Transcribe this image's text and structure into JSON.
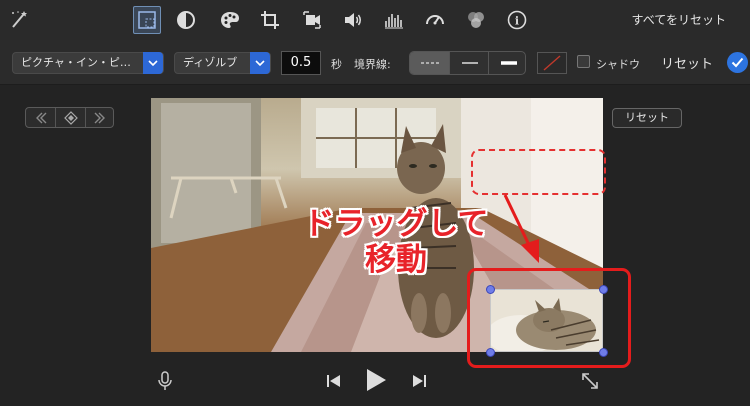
{
  "toolbar": {
    "magic_icon": "magic-wand-icon",
    "tools": [
      {
        "name": "video-overlay-icon",
        "active": true
      },
      {
        "name": "color-balance-icon"
      },
      {
        "name": "color-correction-icon"
      },
      {
        "name": "crop-icon"
      },
      {
        "name": "stabilization-icon"
      },
      {
        "name": "volume-icon"
      },
      {
        "name": "noise-reduction-icon"
      },
      {
        "name": "speed-icon"
      },
      {
        "name": "clip-filter-icon"
      },
      {
        "name": "info-icon"
      }
    ],
    "reset_all_label": "すべてをリセット"
  },
  "controls": {
    "overlay_mode": "ピクチャ・イン・ピ…",
    "transition": "ディゾルブ",
    "duration_value": "0.5",
    "duration_unit": "秒",
    "border_label": "境界線:",
    "border_styles": [
      "dashed",
      "thin",
      "thick"
    ],
    "border_selected": "dashed",
    "shadow_label": "シャドウ",
    "reset_label": "リセット"
  },
  "viewer": {
    "reset_label": "リセット"
  },
  "annotation": {
    "line1": "ドラッグして",
    "line2": "移動"
  },
  "colors": {
    "accent": "#2d68d6",
    "annotation_red": "#e41c1c",
    "handle": "#6f7de8"
  }
}
